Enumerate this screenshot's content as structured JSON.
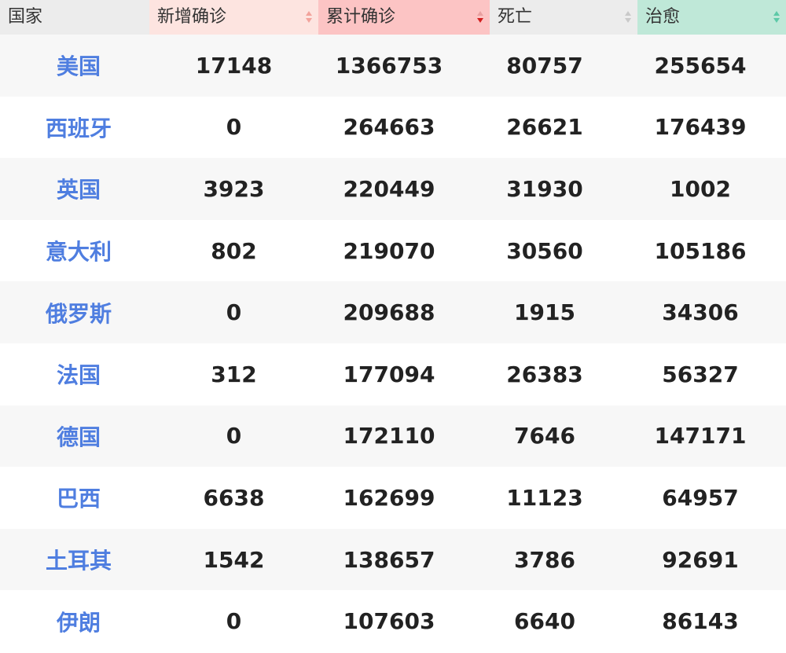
{
  "colors": {
    "country_link": "#4f7ee0",
    "header_country_bg": "#ececec",
    "header_new_bg": "#fde4e0",
    "header_total_bg": "#fcc4c4",
    "header_death_bg": "#ececec",
    "header_recovered_bg": "#bfe8d8",
    "sort_inactive": "#c9c9c9",
    "sort_new": "#f2a39c",
    "sort_total_up": "#e8a0a0",
    "sort_total_down": "#d21f1f",
    "sort_recovered": "#5cc9a7"
  },
  "table": {
    "headers": [
      {
        "label": "国家",
        "sortable": false
      },
      {
        "label": "新增确诊",
        "sortable": true
      },
      {
        "label": "累计确诊",
        "sortable": true,
        "active": "descending"
      },
      {
        "label": "死亡",
        "sortable": true
      },
      {
        "label": "治愈",
        "sortable": true
      }
    ],
    "rows": [
      {
        "country": "美国",
        "new": "17148",
        "total": "1366753",
        "deaths": "80757",
        "recovered": "255654"
      },
      {
        "country": "西班牙",
        "new": "0",
        "total": "264663",
        "deaths": "26621",
        "recovered": "176439"
      },
      {
        "country": "英国",
        "new": "3923",
        "total": "220449",
        "deaths": "31930",
        "recovered": "1002"
      },
      {
        "country": "意大利",
        "new": "802",
        "total": "219070",
        "deaths": "30560",
        "recovered": "105186"
      },
      {
        "country": "俄罗斯",
        "new": "0",
        "total": "209688",
        "deaths": "1915",
        "recovered": "34306"
      },
      {
        "country": "法国",
        "new": "312",
        "total": "177094",
        "deaths": "26383",
        "recovered": "56327"
      },
      {
        "country": "德国",
        "new": "0",
        "total": "172110",
        "deaths": "7646",
        "recovered": "147171"
      },
      {
        "country": "巴西",
        "new": "6638",
        "total": "162699",
        "deaths": "11123",
        "recovered": "64957"
      },
      {
        "country": "土耳其",
        "new": "1542",
        "total": "138657",
        "deaths": "3786",
        "recovered": "92691"
      },
      {
        "country": "伊朗",
        "new": "0",
        "total": "107603",
        "deaths": "6640",
        "recovered": "86143"
      }
    ]
  }
}
